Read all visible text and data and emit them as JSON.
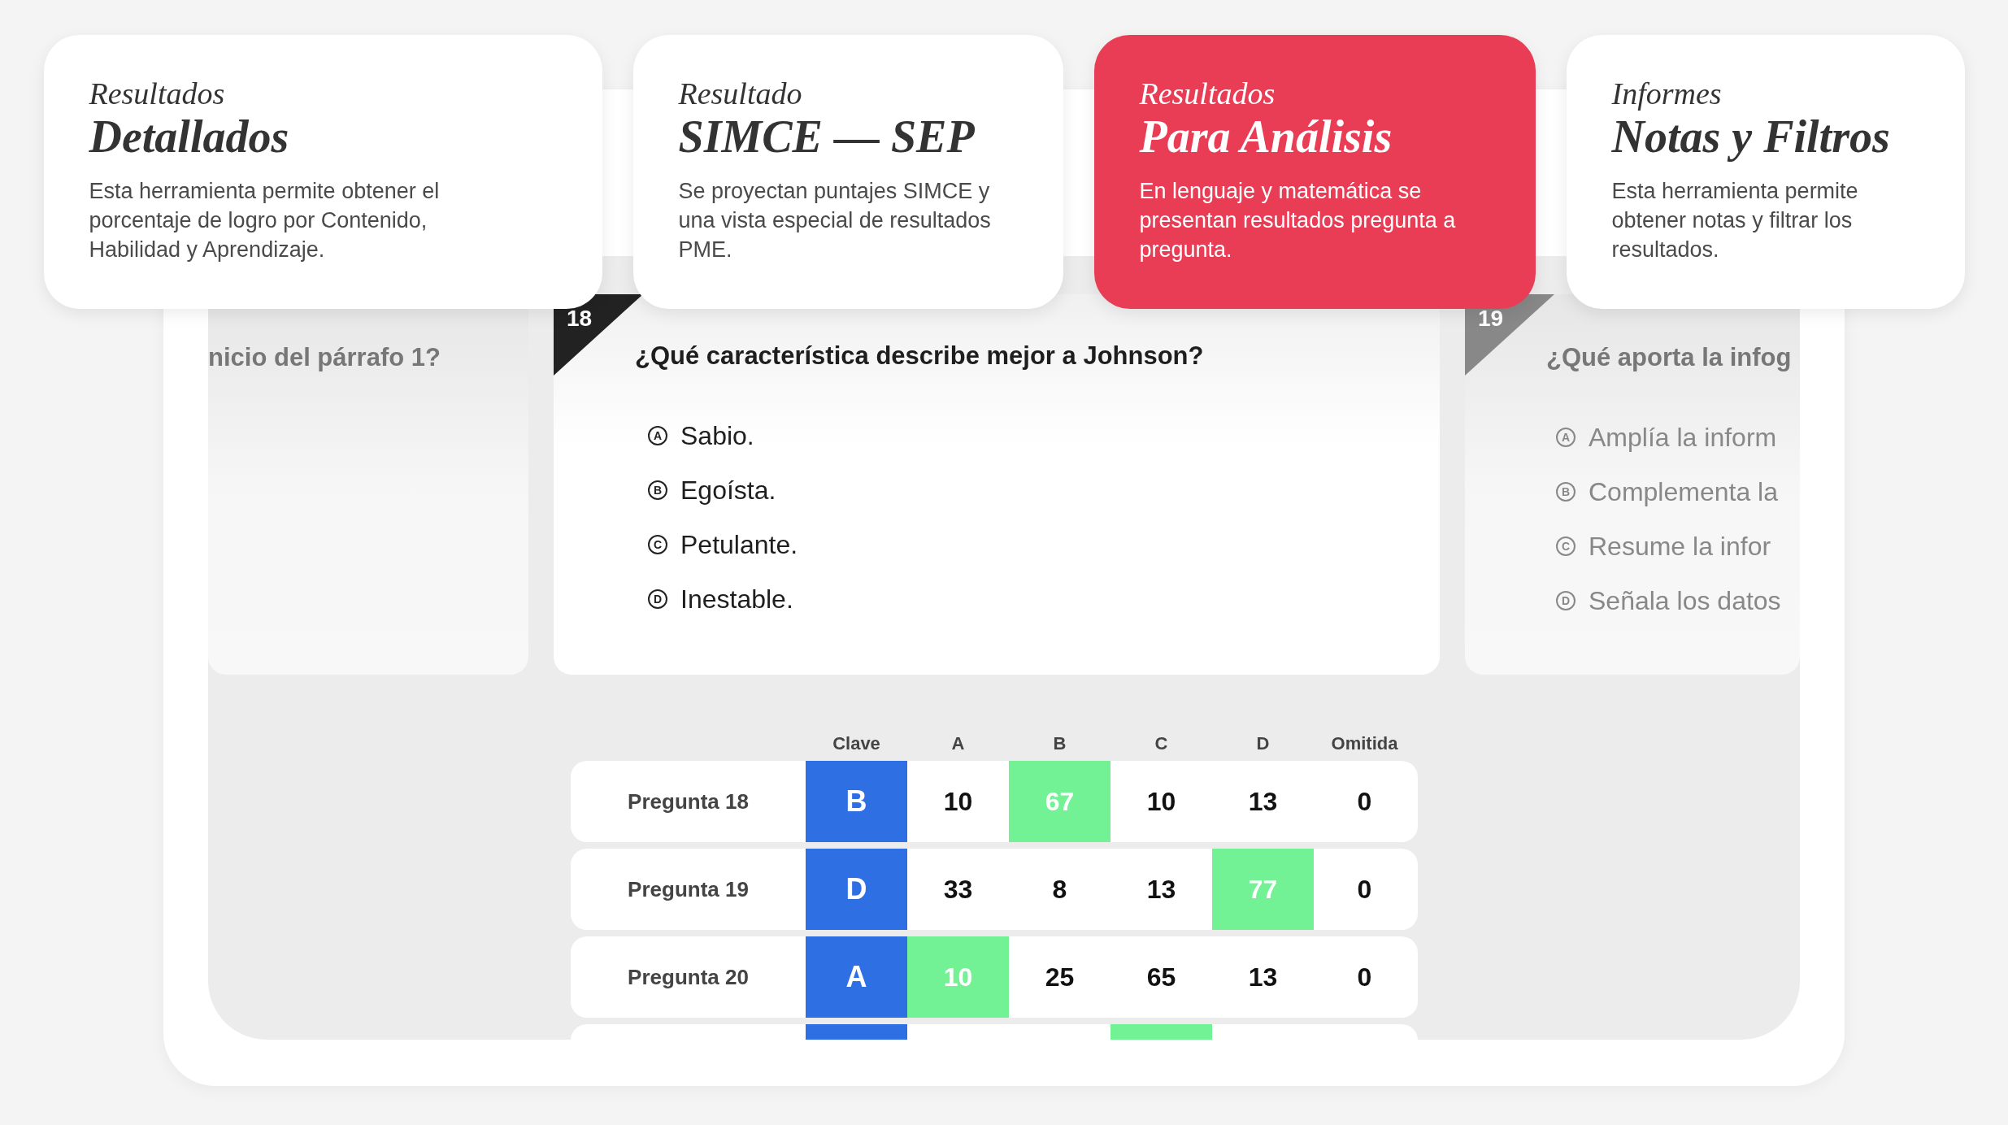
{
  "cards": [
    {
      "overline": "Resultados",
      "title": "Detallados",
      "description": "Esta herramienta permite obtener el porcentaje de logro por Contenido, Habilidad y Aprendizaje.",
      "selected": false
    },
    {
      "overline": "Resultado",
      "title": "SIMCE — SEP",
      "description": "Se proyectan puntajes SIMCE y una vista especial de resultados PME.",
      "selected": false
    },
    {
      "overline": "Resultados",
      "title": "Para Análisis",
      "description": "En lenguaje y matemática se presentan resultados pregunta a pregunta.",
      "selected": true
    },
    {
      "overline": "Informes",
      "title": "Notas y Filtros",
      "description": "Esta herramienta permite obtener notas y filtrar los resultados.",
      "selected": false
    }
  ],
  "questions": [
    {
      "kind": "side",
      "text": "nicio del párrafo 1?"
    },
    {
      "kind": "focused",
      "number": "18",
      "text": "¿Qué característica describe mejor a Johnson?",
      "options": [
        {
          "letter": "A",
          "text": "Sabio."
        },
        {
          "letter": "B",
          "text": "Egoísta."
        },
        {
          "letter": "C",
          "text": "Petulante."
        },
        {
          "letter": "D",
          "text": "Inestable."
        }
      ]
    },
    {
      "kind": "side",
      "number": "19",
      "text": "¿Qué aporta la infog",
      "options": [
        {
          "letter": "A",
          "text": "Amplía la inform"
        },
        {
          "letter": "B",
          "text": "Complementa la"
        },
        {
          "letter": "C",
          "text": "Resume la infor"
        },
        {
          "letter": "D",
          "text": "Señala los datos"
        }
      ]
    }
  ],
  "table": {
    "columns": [
      "",
      "Clave",
      "A",
      "B",
      "C",
      "D",
      "Omitida"
    ],
    "rows": [
      {
        "cells": [
          {
            "kind": "label",
            "value": "Pregunta 18"
          },
          {
            "kind": "key",
            "value": "B"
          },
          {
            "value": "10",
            "correct": false
          },
          {
            "value": "67",
            "correct": true
          },
          {
            "value": "10",
            "correct": false
          },
          {
            "value": "13",
            "correct": false
          },
          {
            "value": "0",
            "correct": false
          }
        ]
      },
      {
        "cells": [
          {
            "kind": "label",
            "value": "Pregunta 19"
          },
          {
            "kind": "key",
            "value": "D"
          },
          {
            "value": "33",
            "correct": false
          },
          {
            "value": "8",
            "correct": false
          },
          {
            "value": "13",
            "correct": false
          },
          {
            "value": "77",
            "correct": true
          },
          {
            "value": "0",
            "correct": false
          }
        ]
      },
      {
        "cells": [
          {
            "kind": "label",
            "value": "Pregunta 20"
          },
          {
            "kind": "key",
            "value": "A"
          },
          {
            "value": "10",
            "correct": true
          },
          {
            "value": "25",
            "correct": false
          },
          {
            "value": "65",
            "correct": false
          },
          {
            "value": "13",
            "correct": false
          },
          {
            "value": "0",
            "correct": false
          }
        ]
      },
      {
        "cells": [
          {
            "kind": "label"
          },
          {
            "kind": "key"
          },
          {
            "correct": false
          },
          {
            "correct": false
          },
          {
            "correct": true
          },
          {
            "correct": false
          },
          {
            "correct": false
          }
        ]
      }
    ]
  }
}
